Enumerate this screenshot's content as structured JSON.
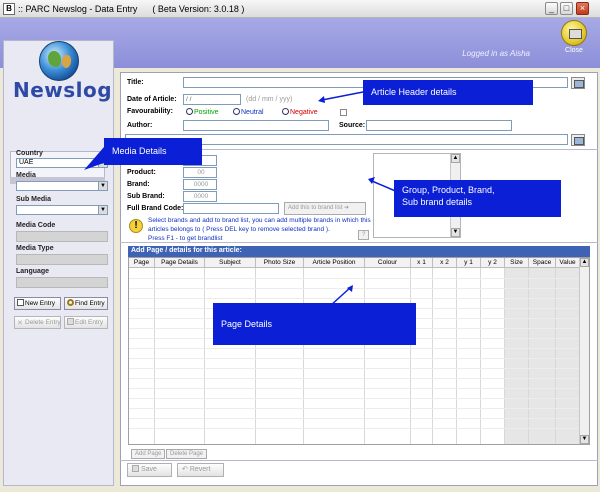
{
  "window": {
    "app_icon": "app-icon",
    "title": ":: PARC Newslog - Data Entry      ( Beta Version: 3.0.18 )"
  },
  "header": {
    "logged_in": "Logged in as Aisha",
    "close_label": "Close"
  },
  "brand": {
    "name": "Newslog"
  },
  "sidebar": {
    "section": "Data Entry",
    "country_label": "Country",
    "country_value": "UAE",
    "media_label": "Media",
    "media_value": "",
    "submedia_label": "Sub Media",
    "submedia_value": "",
    "media_code_label": "Media Code",
    "media_type_label": "Media Type",
    "language_label": "Language",
    "buttons": {
      "new_entry": "New Entry",
      "find_entry": "Find Entry",
      "delete_entry": "Delete Entry",
      "edit_entry": "Edit Entry"
    }
  },
  "article": {
    "title_label": "Title:",
    "date_label": "Date of Article:",
    "date_value": "  / /",
    "date_hint": "(dd / mm / yyy)",
    "favourability_label": "Favourability:",
    "fav_positive": "Positive",
    "fav_neutral": "Neutral",
    "fav_negative": "Negative",
    "author_label": "Author:",
    "source_label": "Source:"
  },
  "brands": {
    "product_label": "Product:",
    "product_value": "00",
    "brand_label": "Brand:",
    "brand_value": "0000",
    "subbrand_label": "Sub Brand:",
    "subbrand_value": "0000",
    "full_code_label": "Full Brand Code:",
    "add_button": "Add this to brand list",
    "info_line1": "Select brands and add to brand list, you can add multiple brands in which this",
    "info_line2": "articles belongs to ( Press DEL key to remove selected brand ).",
    "info_line3": "Press F1 - to get brandlist",
    "help_button": "?"
  },
  "pages": {
    "header": "Add Page / details for this article:",
    "columns": [
      "Page",
      "Page Details",
      "Subject",
      "Photo Size",
      "Article Position",
      "Colour",
      "x 1",
      "x 2",
      "y 1",
      "y 2",
      "Size",
      "Space",
      "Value"
    ],
    "add_page": "Add Page",
    "delete_page": "Delete Page",
    "save": "Save",
    "revert": "Revert"
  },
  "callouts": {
    "header": "Article Header details",
    "media": "Media Details",
    "brands_line1": "Group, Product, Brand,",
    "brands_line2": "Sub brand details",
    "pages": "Page Details"
  },
  "colors": {
    "header_bg": "#9a9ce0",
    "callout_bg": "#0b1fd6",
    "grid_header": "#3e63b5",
    "brand_text": "#2e4aa6",
    "positive": "#00a000",
    "neutral": "#1030c0",
    "negative": "#d00000"
  }
}
